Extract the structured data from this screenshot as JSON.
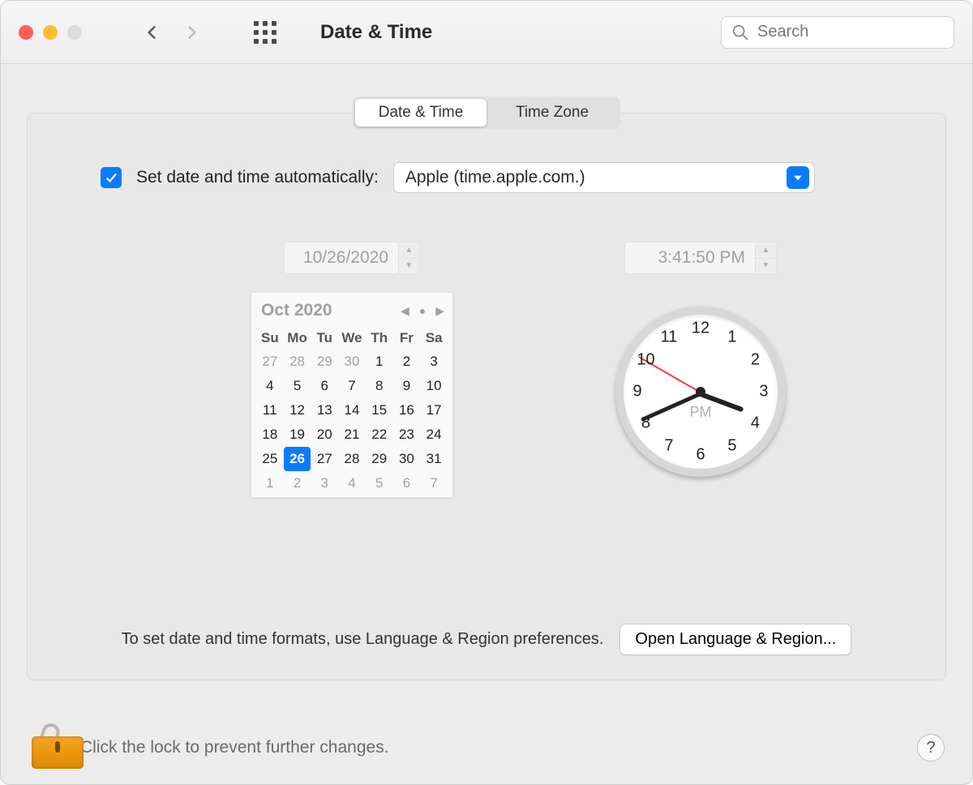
{
  "toolbar": {
    "title": "Date & Time",
    "search_placeholder": "Search"
  },
  "tabs": {
    "date_time": "Date & Time",
    "time_zone": "Time Zone",
    "active": "date_time"
  },
  "auto": {
    "checked": true,
    "label": "Set date and time automatically:",
    "server": "Apple (time.apple.com.)"
  },
  "date_field": "10/26/2020",
  "time_field": "3:41:50 PM",
  "calendar": {
    "month_label": "Oct 2020",
    "dow": [
      "Su",
      "Mo",
      "Tu",
      "We",
      "Th",
      "Fr",
      "Sa"
    ],
    "leading_other": [
      27,
      28,
      29,
      30
    ],
    "days_in_month": 31,
    "trailing_other": [
      1,
      2,
      3,
      4,
      5,
      6,
      7
    ],
    "selected": 26
  },
  "clock": {
    "hour": 3,
    "minute": 41,
    "second": 50,
    "ampm": "PM"
  },
  "format_hint": "To set date and time formats, use Language & Region preferences.",
  "open_lang_region": "Open Language & Region...",
  "lock_hint": "Click the lock to prevent further changes.",
  "help_label": "?"
}
